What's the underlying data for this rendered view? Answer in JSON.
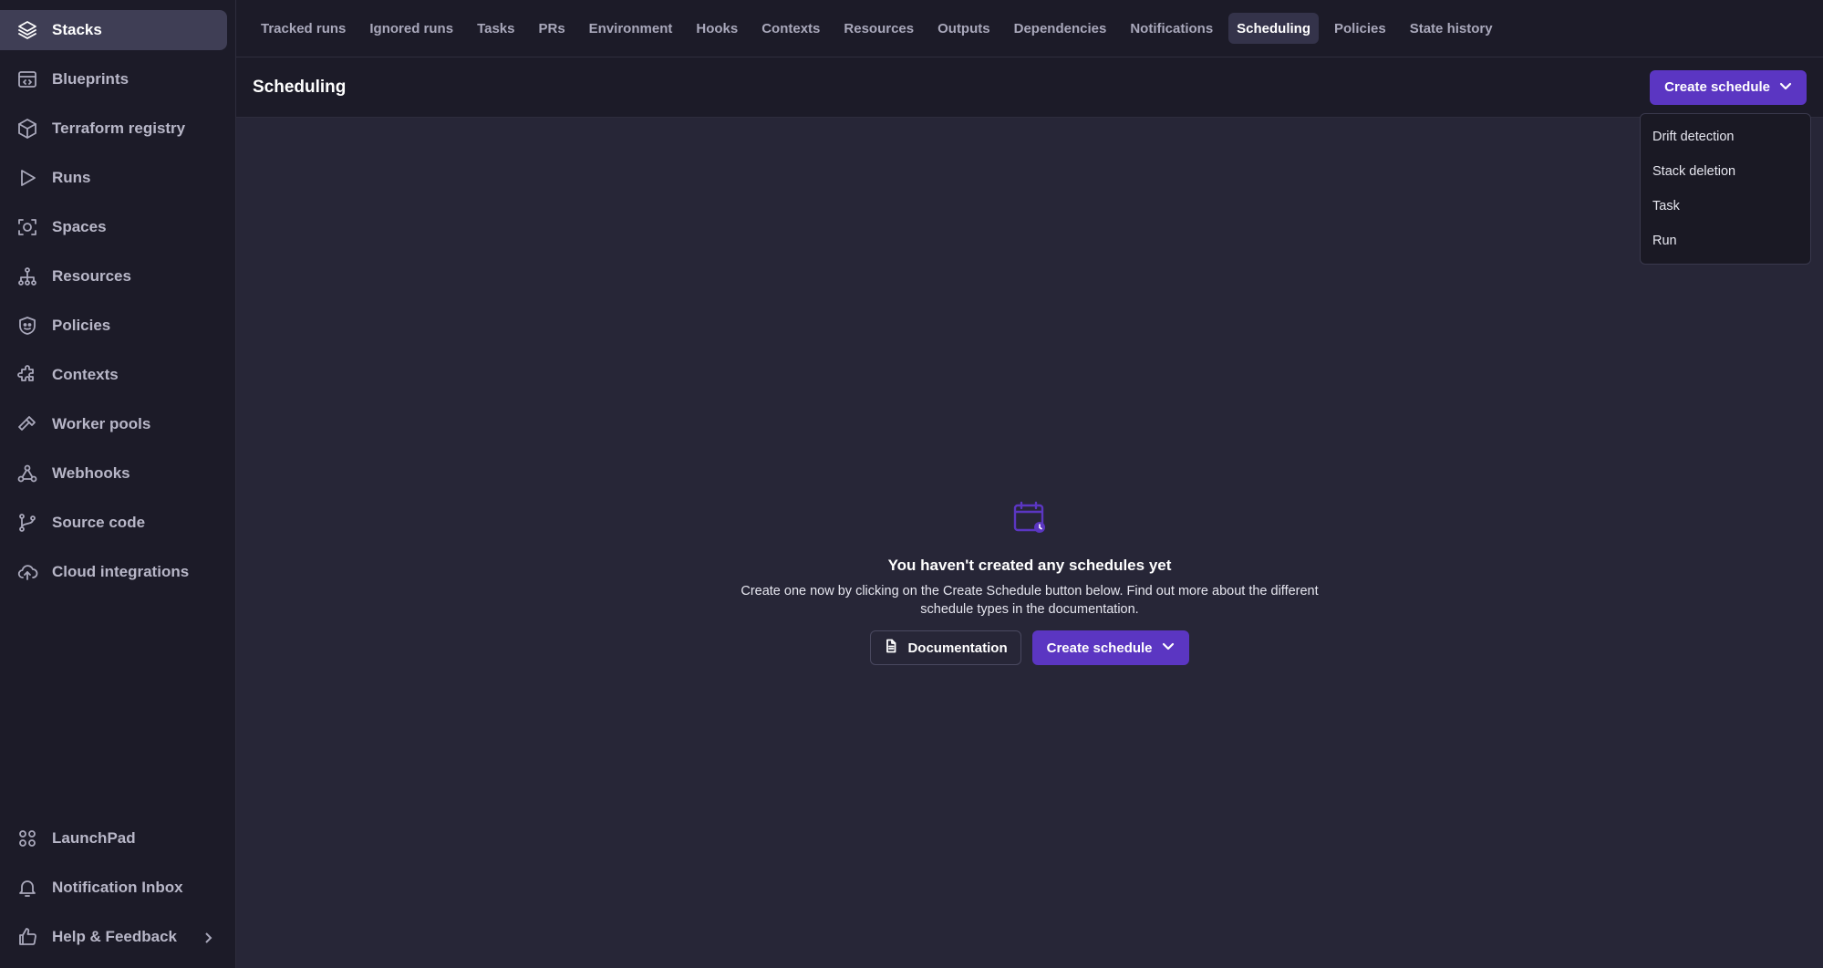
{
  "sidebar": {
    "top_items": [
      {
        "label": "Stacks",
        "icon": "layers-icon",
        "active": true
      },
      {
        "label": "Blueprints",
        "icon": "blueprint-icon"
      },
      {
        "label": "Terraform registry",
        "icon": "cube-icon"
      },
      {
        "label": "Runs",
        "icon": "play-icon"
      },
      {
        "label": "Spaces",
        "icon": "spaces-icon"
      },
      {
        "label": "Resources",
        "icon": "hierarchy-icon"
      },
      {
        "label": "Policies",
        "icon": "shield-icon"
      },
      {
        "label": "Contexts",
        "icon": "puzzle-icon"
      },
      {
        "label": "Worker pools",
        "icon": "hammer-icon"
      },
      {
        "label": "Webhooks",
        "icon": "webhook-icon"
      },
      {
        "label": "Source code",
        "icon": "git-branch-icon"
      },
      {
        "label": "Cloud integrations",
        "icon": "cloud-upload-icon"
      }
    ],
    "bottom_items": [
      {
        "label": "LaunchPad",
        "icon": "grid-circles-icon"
      },
      {
        "label": "Notification Inbox",
        "icon": "bell-icon"
      },
      {
        "label": "Help & Feedback",
        "icon": "thumbs-up-icon"
      }
    ]
  },
  "tabs": [
    {
      "label": "Tracked runs"
    },
    {
      "label": "Ignored runs"
    },
    {
      "label": "Tasks"
    },
    {
      "label": "PRs"
    },
    {
      "label": "Environment"
    },
    {
      "label": "Hooks"
    },
    {
      "label": "Contexts"
    },
    {
      "label": "Resources"
    },
    {
      "label": "Outputs"
    },
    {
      "label": "Dependencies"
    },
    {
      "label": "Notifications"
    },
    {
      "label": "Scheduling",
      "active": true
    },
    {
      "label": "Policies"
    },
    {
      "label": "State history"
    }
  ],
  "header": {
    "title": "Scheduling",
    "create_label": "Create schedule"
  },
  "dropdown": {
    "items": [
      "Drift detection",
      "Stack deletion",
      "Task",
      "Run"
    ]
  },
  "empty": {
    "title": "You haven't created any schedules yet",
    "description": "Create one now by clicking on the Create Schedule button below. Find out more about the different schedule types in the documentation.",
    "docs_label": "Documentation",
    "create_label": "Create schedule"
  },
  "colors": {
    "accent": "#5b36c2",
    "sidebar_bg": "#1c1b28",
    "content_bg": "#272637"
  }
}
